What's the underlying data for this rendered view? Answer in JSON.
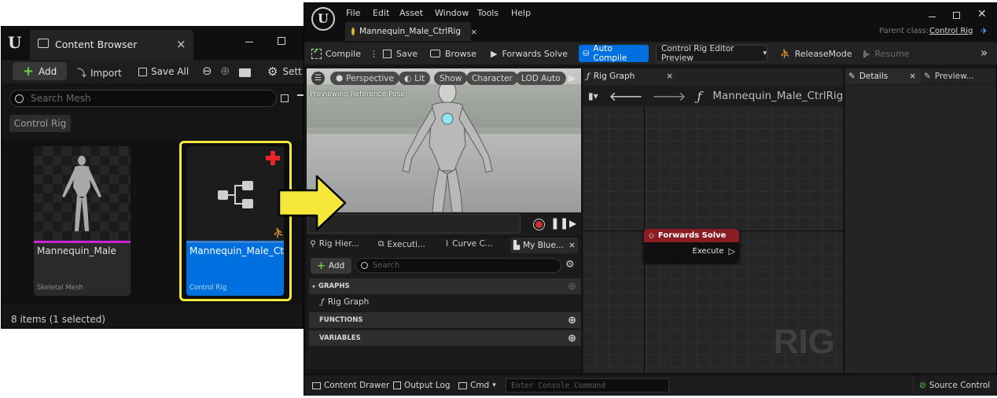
{
  "content_browser": {
    "tab_title": "Content Browser",
    "close": "×",
    "toolbar": {
      "add_label": "Add",
      "import_label": "Import",
      "save_all_label": "Save All",
      "settings_label": "Sett"
    },
    "search_placeholder": "Search Mesh",
    "filter_chip": "Control Rig",
    "assets": [
      {
        "name": "Mannequin_Male",
        "type": "Skeletal Mesh"
      },
      {
        "name": "Mannequin_Male_CtrlRig",
        "type": "Control Rig"
      }
    ],
    "status": "8 items (1 selected)"
  },
  "editor": {
    "menu": [
      "File",
      "Edit",
      "Asset",
      "Window",
      "Tools",
      "Help"
    ],
    "doc_tab": "Mannequin_Male_CtrlRig",
    "parent_class_label": "Parent class:",
    "parent_class_value": "Control Rig",
    "toolbar": {
      "compile": "Compile",
      "save": "Save",
      "browse": "Browse",
      "forwards_solve": "Forwards Solve",
      "auto_compile": "Auto Compile",
      "preview_dropdown": "Control Rig Editor Preview",
      "release_mode": "ReleaseMode",
      "resume": "Resume"
    },
    "viewport": {
      "pills": [
        "Perspective",
        "Lit",
        "Show",
        "Character",
        "LOD Auto"
      ],
      "overlay_text": "Previewing Reference Pose"
    },
    "bottom_tabs": [
      "Rig Hier...",
      "Executi...",
      "Curve C...",
      "My Blue..."
    ],
    "my_blueprint": {
      "add_label": "Add",
      "search_placeholder": "Search",
      "sections": {
        "graphs": "GRAPHS",
        "graph_item": "Rig Graph",
        "functions": "FUNCTIONS",
        "variables": "VARIABLES"
      }
    },
    "graph": {
      "tab": "Rig Graph",
      "breadcrumb": "Mannequin_Male_CtrlRig",
      "node_title": "Forwards Solve",
      "node_pin": "Execute",
      "watermark": "RIG"
    },
    "details_tab": "Details",
    "preview_tab": "Preview...",
    "statusbar": {
      "content_drawer": "Content Drawer",
      "output_log": "Output Log",
      "cmd": "Cmd",
      "console_placeholder": "Enter Console Command",
      "source_control": "Source Control"
    }
  },
  "colors": {
    "accent_blue": "#0070e0",
    "highlight_yellow": "#f6e83a",
    "node_header_red": "#8a1c22",
    "skeletal_mesh_bar": "#c626d6",
    "control_rig_bar": "#3a7fd0"
  }
}
